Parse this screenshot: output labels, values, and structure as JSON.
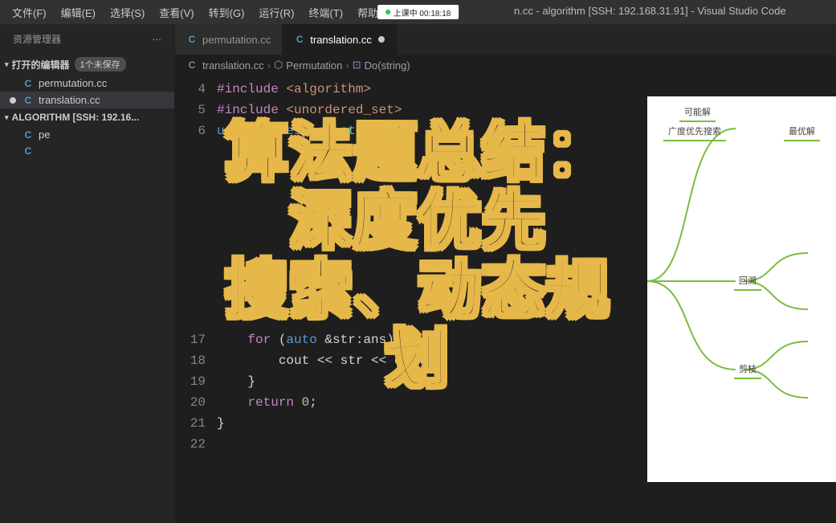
{
  "menubar": {
    "file": "文件(F)",
    "edit": "编辑(E)",
    "select": "选择(S)",
    "view": "查看(V)",
    "goto": "转到(G)",
    "run": "运行(R)",
    "terminal": "终端(T)",
    "help": "帮助(H)"
  },
  "title": {
    "status": "上课中 00:18:18",
    "suffix": "n.cc - algorithm [SSH: 192.168.31.91] - Visual Studio Code"
  },
  "sidebar": {
    "header": "资源管理器",
    "open_editors": "打开的编辑器",
    "unsaved_badge": "1个未保存",
    "files": {
      "permutation": "permutation.cc",
      "translation": "translation.cc"
    },
    "workspace": "ALGORITHM [SSH: 192.16...",
    "root_files": {
      "pe": "pe",
      "other": ""
    }
  },
  "tabs": {
    "permutation": "permutation.cc",
    "translation": "translation.cc"
  },
  "breadcrumb": {
    "file": "translation.cc",
    "class": "Permutation",
    "method": "Do(string)"
  },
  "code": {
    "lines": [
      {
        "n": "4",
        "t": "#include <algorithm>"
      },
      {
        "n": "5",
        "t": "#include <unordered_set>"
      },
      {
        "n": "6",
        "t": "using namespace std;"
      },
      {
        "n": "",
        "t": ""
      },
      {
        "n": "",
        "t": ""
      },
      {
        "n": "",
        "t": ""
      },
      {
        "n": "",
        "t": ""
      },
      {
        "n": "",
        "t": ""
      },
      {
        "n": "",
        "t": ""
      },
      {
        "n": "",
        "t": ""
      },
      {
        "n": "",
        "t": ""
      },
      {
        "n": "",
        "t": ""
      },
      {
        "n": "17",
        "t": "    for (auto &str:ans) {"
      },
      {
        "n": "18",
        "t": "        cout << str << endl;"
      },
      {
        "n": "19",
        "t": "    }"
      },
      {
        "n": "20",
        "t": "    return 0;"
      },
      {
        "n": "21",
        "t": "}"
      },
      {
        "n": "22",
        "t": ""
      }
    ]
  },
  "mindmap": {
    "n1": "可能解",
    "n2": "广度优先搜索",
    "n3": "最优解",
    "n4": "回溯",
    "n5": "剪枝"
  },
  "overlay": {
    "line1": "算法题总结：深度优先",
    "line2": "搜索、动态规划"
  }
}
